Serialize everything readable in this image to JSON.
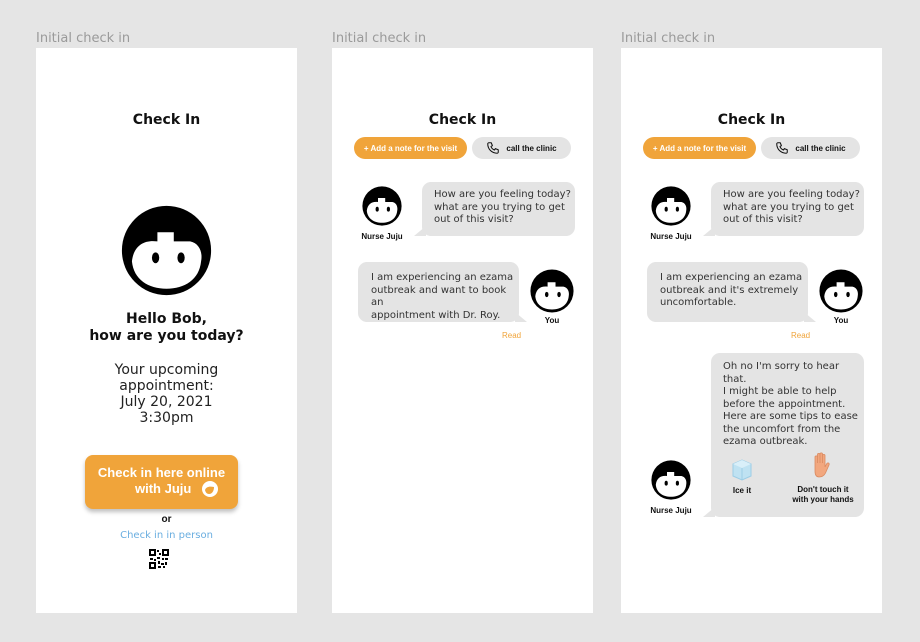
{
  "frames": [
    {
      "label": "Initial check in",
      "title": "Check In",
      "greeting_line1": "Hello Bob,",
      "greeting_line2": "how are you today?",
      "appointment": [
        "Your upcoming",
        "appointment:",
        "July 20, 2021",
        "3:30pm"
      ],
      "checkin_button_line1": "Check in here online",
      "checkin_button_line2": "with Juju",
      "or_text": "or",
      "in_person_link": "Check in in person",
      "icons": [
        "avatar-face-icon",
        "juju-logo-icon",
        "qr-code-icon"
      ]
    },
    {
      "label": "Initial check in",
      "title": "Check In",
      "add_note_button": "+ Add a note for the visit",
      "call_button": "call the clinic",
      "nurse_message": [
        "How are you feeling today?",
        "what are you trying to get",
        "out of this visit?"
      ],
      "nurse_name": "Nurse Juju",
      "user_message": [
        "I am experiencing an ezama",
        "outbreak and want to book an",
        "appointment with Dr. Roy."
      ],
      "user_name": "You",
      "read_status": "Read"
    },
    {
      "label": "Initial check in",
      "title": "Check In",
      "add_note_button": "+ Add a note for the visit",
      "call_button": "call the clinic",
      "nurse_message": [
        "How are you feeling today?",
        "what are you trying to get",
        "out of this visit?"
      ],
      "nurse_name": "Nurse Juju",
      "user_message": [
        "I am experiencing an ezama",
        "outbreak and it's extremely",
        "uncomfortable."
      ],
      "user_name": "You",
      "read_status": "Read",
      "nurse_reply": [
        "Oh no I'm sorry to hear that.",
        "I might be able to help",
        "before the appointment.",
        "Here are some tips to ease",
        "the uncomfort from the",
        "ezama outbreak."
      ],
      "tip_ice": "Ice it",
      "tip_hands_line1": "Don't touch it",
      "tip_hands_line2": "with your hands",
      "nurse_name_2": "Nurse Juju"
    }
  ],
  "colors": {
    "accent": "#f0a43a",
    "link": "#6aaee0",
    "bubble": "#e4e4e4",
    "canvas": "#e5e5e5"
  }
}
